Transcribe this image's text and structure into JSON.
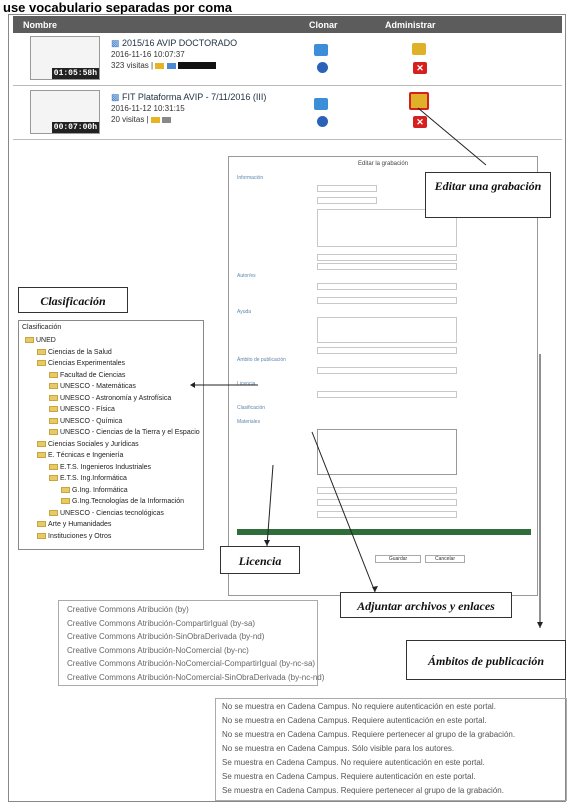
{
  "caption": "use vocabulario separadas por coma",
  "table": {
    "headers": [
      "Nombre",
      "Clonar",
      "Administrar"
    ],
    "rows": [
      {
        "duration": "01:05:58h",
        "title": "2015/16 AVIP DOCTORADO",
        "date": "2016-11-16 10:07:37",
        "visits": "323 visitas |"
      },
      {
        "duration": "00:07:00h",
        "title": "FIT Plataforma AVIP - 7/11/2016 (III)",
        "date": "2016-11-12 10:31:15",
        "visits": "20 visitas |"
      }
    ]
  },
  "form": {
    "header": "Editar la grabación",
    "sections": [
      "Información",
      "Autor/es",
      "Ayuda",
      "Ámbito de publicación",
      "Licencia",
      "Clasificación",
      "Materiales"
    ],
    "buttons": [
      "Guardar",
      "Cancelar"
    ]
  },
  "callouts": {
    "editar": "Editar una grabación",
    "clasificacion": "Clasificación",
    "licencia": "Licencia",
    "adjuntar": "Adjuntar archivos y enlaces",
    "ambitos": "Ámbitos de publicación"
  },
  "tree": {
    "header": "Clasificación",
    "items": [
      {
        "label": "UNED",
        "level": 0
      },
      {
        "label": "Ciencias de la Salud",
        "level": 1
      },
      {
        "label": "Ciencias Experimentales",
        "level": 1
      },
      {
        "label": "Facultad de Ciencias",
        "level": 2
      },
      {
        "label": "UNESCO - Matemáticas",
        "level": 2
      },
      {
        "label": "UNESCO - Astronomía y Astrofísica",
        "level": 2
      },
      {
        "label": "UNESCO - Física",
        "level": 2
      },
      {
        "label": "UNESCO - Química",
        "level": 2
      },
      {
        "label": "UNESCO - Ciencias de la Tierra y el Espacio",
        "level": 2
      },
      {
        "label": "Ciencias Sociales y Jurídicas",
        "level": 1
      },
      {
        "label": "E. Técnicas e Ingeniería",
        "level": 1
      },
      {
        "label": "E.T.S. Ingenieros Industriales",
        "level": 2
      },
      {
        "label": "E.T.S. Ing.Informática",
        "level": 2
      },
      {
        "label": "G.Ing. Informática",
        "level": 3
      },
      {
        "label": "G.Ing.Tecnologías de la Información",
        "level": 3
      },
      {
        "label": "UNESCO - Ciencias tecnológicas",
        "level": 2
      },
      {
        "label": "Arte y Humanidades",
        "level": 1
      },
      {
        "label": "Instituciones y Otros",
        "level": 1
      }
    ]
  },
  "licenses": [
    "Creative Commons Atribución (by)",
    "Creative Commons Atribución-CompartirIgual (by-sa)",
    "Creative Commons Atribución-SinObraDerivada (by-nd)",
    "Creative Commons Atribución-NoComercial (by-nc)",
    "Creative Commons Atribución-NoComercial-CompartirIgual (by-nc-sa)",
    "Creative Commons Atribución-NoComercial-SinObraDerivada (by-nc-nd)"
  ],
  "ambitos": [
    "No se muestra en Cadena Campus. No requiere autenticación en este portal.",
    "No se muestra en Cadena Campus. Requiere autenticación en este portal.",
    "No se muestra en Cadena Campus. Requiere pertenecer al grupo de la grabación.",
    "No se muestra en Cadena Campus. Sólo visible para los autores.",
    "Se muestra en Cadena Campus. No requiere autenticación en este portal.",
    "Se muestra en Cadena Campus. Requiere autenticación en este portal.",
    "Se muestra en Cadena Campus. Requiere pertenecer al grupo de la grabación."
  ],
  "colors": {
    "header_bg": "#5c5c5c",
    "form_bar": "#2f6e3a",
    "delete_red": "#d62020",
    "link_blue": "#5d86b0"
  }
}
